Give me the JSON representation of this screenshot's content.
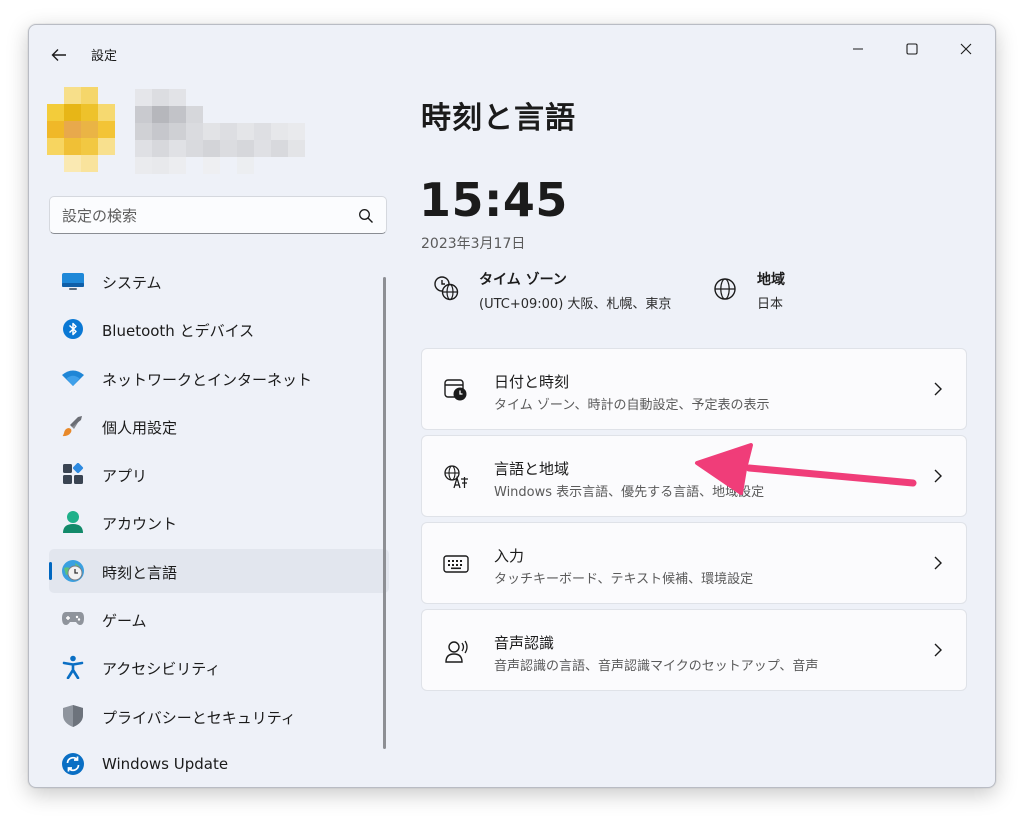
{
  "titlebar": {
    "app_title": "設定",
    "back_icon": "back-arrow-icon",
    "controls": [
      "minimize-icon",
      "maximize-icon",
      "close-icon"
    ]
  },
  "search": {
    "placeholder": "設定の検索",
    "icon": "search-icon"
  },
  "sidebar": {
    "items": [
      {
        "label": "システム",
        "icon": "system-display-icon"
      },
      {
        "label": "Bluetooth とデバイス",
        "icon": "bluetooth-icon"
      },
      {
        "label": "ネットワークとインターネット",
        "icon": "wifi-icon"
      },
      {
        "label": "個人用設定",
        "icon": "paintbrush-icon"
      },
      {
        "label": "アプリ",
        "icon": "apps-icon"
      },
      {
        "label": "アカウント",
        "icon": "account-icon"
      },
      {
        "label": "時刻と言語",
        "icon": "time-language-icon",
        "selected": true
      },
      {
        "label": "ゲーム",
        "icon": "gamepad-icon"
      },
      {
        "label": "アクセシビリティ",
        "icon": "accessibility-icon"
      },
      {
        "label": "プライバシーとセキュリティ",
        "icon": "shield-icon"
      },
      {
        "label": "Windows Update",
        "icon": "windows-update-icon"
      }
    ]
  },
  "main": {
    "title": "時刻と言語",
    "time": "15:45",
    "date": "2023年3月17日",
    "timezone": {
      "title": "タイム ゾーン",
      "value": "(UTC+09:00) 大阪、札幌、東京",
      "icon": "timezone-globe-icon"
    },
    "region": {
      "title": "地域",
      "value": "日本",
      "icon": "globe-icon"
    },
    "cards": [
      {
        "title": "日付と時刻",
        "subtitle": "タイム ゾーン、時計の自動設定、予定表の表示",
        "icon": "calendar-clock-icon"
      },
      {
        "title": "言語と地域",
        "subtitle": "Windows 表示言語、優先する言語、地域設定",
        "icon": "language-icon"
      },
      {
        "title": "入力",
        "subtitle": "タッチキーボード、テキスト候補、環境設定",
        "icon": "keyboard-icon"
      },
      {
        "title": "音声認識",
        "subtitle": "音声認識の言語、音声認識マイクのセットアップ、音声",
        "icon": "speech-icon"
      }
    ]
  },
  "colors": {
    "window_bg": "#eef1f8",
    "accent": "#0067c0",
    "annotation_arrow": "#f03d79"
  }
}
